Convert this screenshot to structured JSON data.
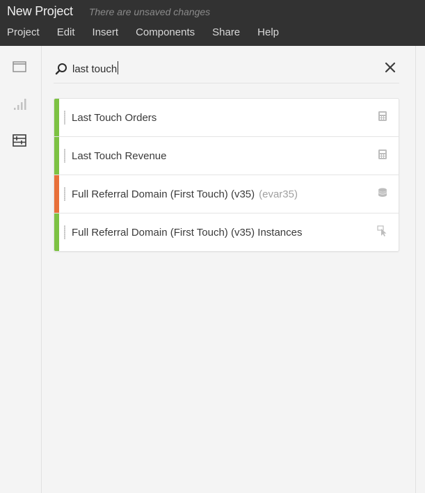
{
  "app": {
    "title": "New Project",
    "unsaved_notice": "There are unsaved changes"
  },
  "menu": [
    "Project",
    "Edit",
    "Insert",
    "Components",
    "Share",
    "Help"
  ],
  "rail": [
    {
      "name": "panels-icon"
    },
    {
      "name": "visualizations-icon"
    },
    {
      "name": "components-icon"
    }
  ],
  "search": {
    "value": "last touch",
    "placeholder": ""
  },
  "results": [
    {
      "label": "Last Touch Orders",
      "sub": "",
      "type_icon": "calculator-icon",
      "accent": "#7dc243"
    },
    {
      "label": "Last Touch Revenue",
      "sub": "",
      "type_icon": "calculator-icon",
      "accent": "#7dc243"
    },
    {
      "label": "Full Referral Domain (First Touch) (v35)",
      "sub": "(evar35)",
      "type_icon": "database-icon",
      "accent": "#e8703a"
    },
    {
      "label": "Full Referral Domain (First Touch) (v35) Instances",
      "sub": "",
      "type_icon": "pointer-icon",
      "accent": "#7dc243"
    }
  ],
  "colors": {
    "topbar": "#323232",
    "metric_accent": "#7dc243",
    "dimension_accent": "#e8703a"
  }
}
